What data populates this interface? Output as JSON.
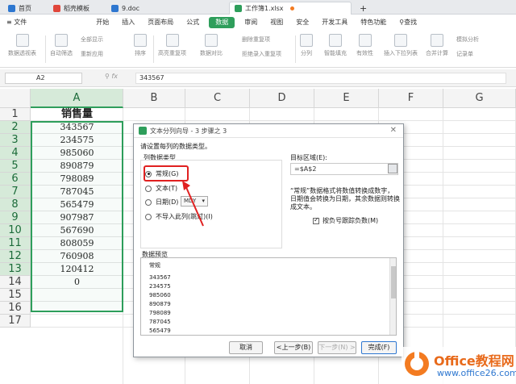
{
  "tabs": [
    {
      "label": "首页",
      "color": "#2e77d0"
    },
    {
      "label": "稻壳模板",
      "color": "#e0463b"
    },
    {
      "label": "9.doc",
      "color": "#2e77d0"
    },
    {
      "label": "工作簿1.xlsx",
      "color": "#2e9e5b",
      "active": true
    }
  ],
  "new_tab_label": "+",
  "menu": [
    "≡ 文件",
    "开始",
    "插入",
    "页面布局",
    "公式",
    "数据",
    "审阅",
    "视图",
    "安全",
    "开发工具",
    "特色功能",
    "查找"
  ],
  "active_menu": "数据",
  "ribbon": {
    "buttons": [
      "数据透视表",
      "自动筛选",
      "全部显示",
      "重新应用",
      "排序",
      "高亮重复项",
      "数据对比",
      "删除重复项",
      "拒绝录入重复项",
      "分列",
      "智能填充",
      "有效性",
      "插入下拉列表",
      "合并计算",
      "模拟分析",
      "记录单"
    ]
  },
  "formula_bar": {
    "name_box": "A2",
    "fx": "fx",
    "value": "343567"
  },
  "columns": [
    "A",
    "B",
    "C",
    "D",
    "E",
    "F",
    "G"
  ],
  "rows": [
    "1",
    "2",
    "3",
    "4",
    "5",
    "6",
    "7",
    "8",
    "9",
    "10",
    "11",
    "12",
    "13",
    "14",
    "15",
    "16",
    "17"
  ],
  "sheet": {
    "header": "销售量",
    "values": [
      "343567",
      "234575",
      "985060",
      "890879",
      "798089",
      "787045",
      "565479",
      "907987",
      "567690",
      "808059",
      "760908",
      "120412",
      "0"
    ]
  },
  "dialog": {
    "title": "文本分列向导 - 3 步骤之 3",
    "instruction": "请设置每列的数据类型。",
    "group_label": "列数据类型",
    "options": [
      "常规(G)",
      "文本(T)",
      "日期(D)",
      "不导入此列(跳过)(I)"
    ],
    "selected_option": 0,
    "date_format": "MDY",
    "dest_label": "目标区域(E):",
    "dest_value": "=$A$2",
    "note": "“常规”数据格式将数值转换成数字，日期值会转换为日期，其余数据则转换成文本。",
    "checkbox_label": "按负号跟踪负数(M)",
    "checkbox_checked": true,
    "preview_label": "数据预览",
    "preview_header": "常规",
    "preview_values": [
      "343567",
      "234575",
      "985060",
      "890879",
      "798089",
      "787045",
      "565479"
    ],
    "buttons": {
      "cancel": "取消",
      "back": "<上一步(B)",
      "next": "下一步(N) >",
      "finish": "完成(F)"
    }
  },
  "watermark": {
    "brand": "Office教程网",
    "url": "www.office26.com"
  },
  "colors": {
    "accent": "#2e9e5b",
    "highlight": "#e02020"
  }
}
